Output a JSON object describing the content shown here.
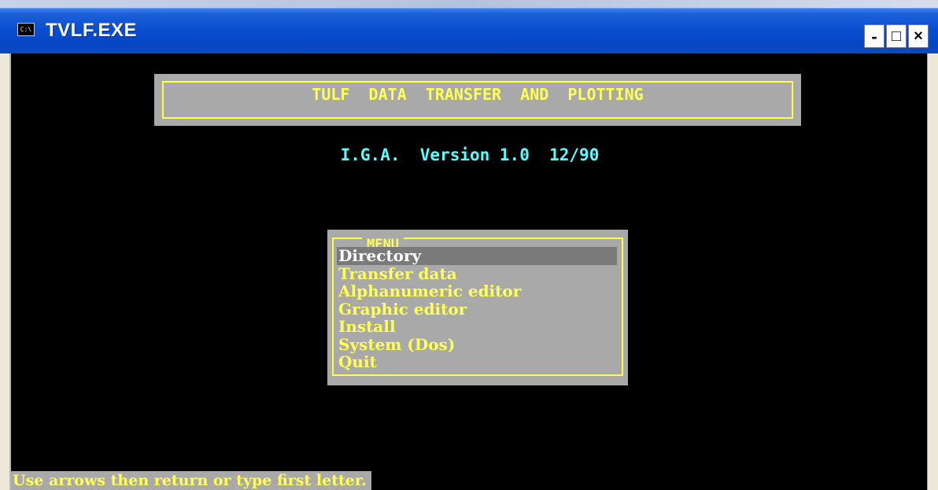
{
  "window": {
    "title": "TVLF.EXE",
    "icon_label": "C:\\",
    "icon_name": "console-icon",
    "minimize_label": "-",
    "maximize_label": "□",
    "close_label": "×"
  },
  "header": {
    "title": "TULF  DATA  TRANSFER  AND  PLOTTING"
  },
  "version": {
    "text": "I.G.A.  Version 1.0  12/90"
  },
  "menu": {
    "caption": "MENU",
    "selected_index": 0,
    "items": [
      {
        "label": "Directory"
      },
      {
        "label": "Transfer data"
      },
      {
        "label": "Alphanumeric editor"
      },
      {
        "label": "Graphic editor"
      },
      {
        "label": "Install"
      },
      {
        "label": "System (Dos)"
      },
      {
        "label": "Quit"
      }
    ]
  },
  "status": {
    "text": "Use arrows then return or type first letter."
  },
  "colors": {
    "console_bg": "#000000",
    "panel_gray": "#a9a9a9",
    "yellow_text": "#ffff55",
    "cyan_text": "#55ffff",
    "selection_bg": "#7a7a7a",
    "titlebar_blue": "#0a4fd1"
  }
}
